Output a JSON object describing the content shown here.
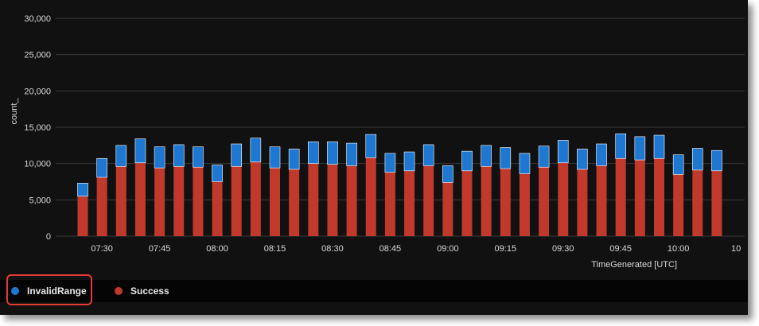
{
  "chart_data": {
    "type": "bar",
    "stacked": true,
    "ylabel": "count_",
    "xlabel": "TimeGenerated [UTC]",
    "ylim": [
      0,
      30000
    ],
    "yticks": [
      0,
      5000,
      10000,
      15000,
      20000,
      25000,
      30000
    ],
    "ytick_labels": [
      "0",
      "5,000",
      "10,000",
      "15,000",
      "20,000",
      "25,000",
      "30,000"
    ],
    "xticks": [
      "07:30",
      "07:45",
      "08:00",
      "08:15",
      "08:30",
      "08:45",
      "09:00",
      "09:15",
      "09:30",
      "09:45",
      "10:00",
      "10"
    ],
    "grid": true,
    "legend_placement": "bottom",
    "categories": [
      "07:25",
      "07:30",
      "07:35",
      "07:40",
      "07:45",
      "07:50",
      "07:55",
      "08:00",
      "08:05",
      "08:10",
      "08:15",
      "08:20",
      "08:25",
      "08:30",
      "08:35",
      "08:40",
      "08:45",
      "08:50",
      "08:55",
      "09:00",
      "09:05",
      "09:10",
      "09:15",
      "09:20",
      "09:25",
      "09:30",
      "09:35",
      "09:40",
      "09:45",
      "09:50",
      "09:55",
      "10:00",
      "10:05",
      "10:10"
    ],
    "series": [
      {
        "name": "Success",
        "color": "#c0392b",
        "values": [
          5500,
          8100,
          9600,
          10100,
          9400,
          9600,
          9500,
          7500,
          9600,
          10200,
          9400,
          9200,
          10000,
          9900,
          9700,
          10800,
          8800,
          9000,
          9700,
          7400,
          9000,
          9600,
          9300,
          8600,
          9500,
          10100,
          9200,
          9700,
          10700,
          10500,
          10700,
          8500,
          9100,
          9000
        ]
      },
      {
        "name": "InvalidRange",
        "color": "#1e78d2",
        "values": [
          1800,
          2600,
          2900,
          3300,
          2900,
          3000,
          2800,
          2300,
          3100,
          3300,
          2900,
          2800,
          3000,
          3100,
          3100,
          3200,
          2600,
          2600,
          2900,
          2300,
          2700,
          2900,
          2900,
          2800,
          2900,
          3100,
          2800,
          3000,
          3400,
          3200,
          3200,
          2700,
          3000,
          2800
        ]
      }
    ]
  },
  "legend": {
    "items": [
      {
        "label": "InvalidRange",
        "color": "#1e78d2"
      },
      {
        "label": "Success",
        "color": "#c0392b"
      }
    ]
  }
}
